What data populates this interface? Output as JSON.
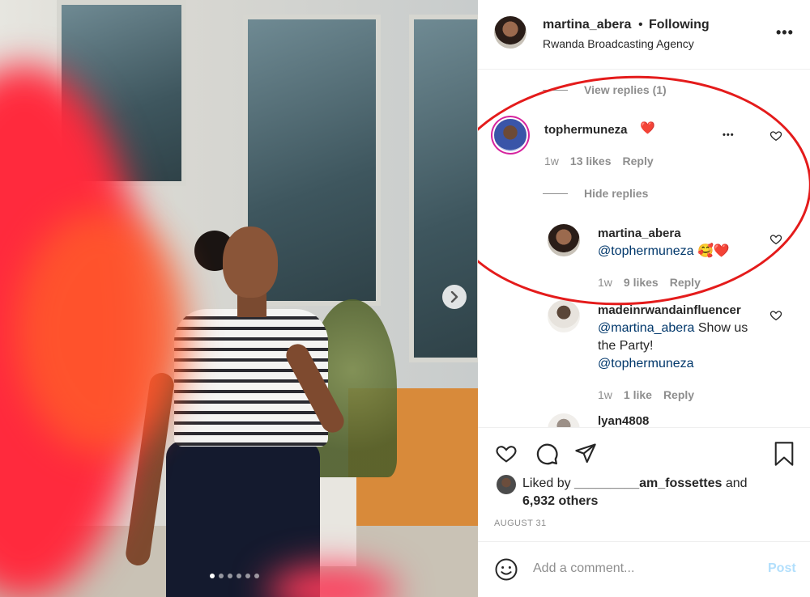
{
  "post": {
    "author": "martina_abera",
    "follow_separator": "•",
    "follow_status": "Following",
    "location": "Rwanda Broadcasting Agency",
    "more_label": "•••"
  },
  "comments": {
    "view_replies": "View replies (1)",
    "items": [
      {
        "username": "tophermuneza",
        "text_emoji": "❤️",
        "time": "1w",
        "likes": "13 likes",
        "reply": "Reply",
        "hide_replies": "Hide replies",
        "more": "•••"
      },
      {
        "username": "martina_abera",
        "mention": "@tophermuneza",
        "emoji": "🥰❤️",
        "time": "1w",
        "likes": "9 likes",
        "reply": "Reply"
      },
      {
        "username": "madeinrwandainfluencer",
        "mention": "@martina_abera",
        "text": " Show us the Party!",
        "mention2": "@tophermuneza",
        "time": "1w",
        "likes": "1 like",
        "reply": "Reply"
      },
      {
        "username": "lyan4808"
      }
    ]
  },
  "likes": {
    "prefix": "Liked by ",
    "user": "_________am_fossettes",
    "middle": " and",
    "count": "6,932 others"
  },
  "date": "AUGUST 31",
  "composer": {
    "placeholder": "Add a comment...",
    "post_label": "Post"
  },
  "icons": [
    "heart-icon",
    "comment-icon",
    "share-icon",
    "save-icon",
    "emoji-icon",
    "chevron-right-icon"
  ],
  "colors": {
    "annotation": "#e41b1b",
    "mention": "#00376b",
    "post_disabled": "#b2dffc",
    "muted": "#8e8e8e"
  },
  "carousel": {
    "count": 6,
    "active": 1
  }
}
